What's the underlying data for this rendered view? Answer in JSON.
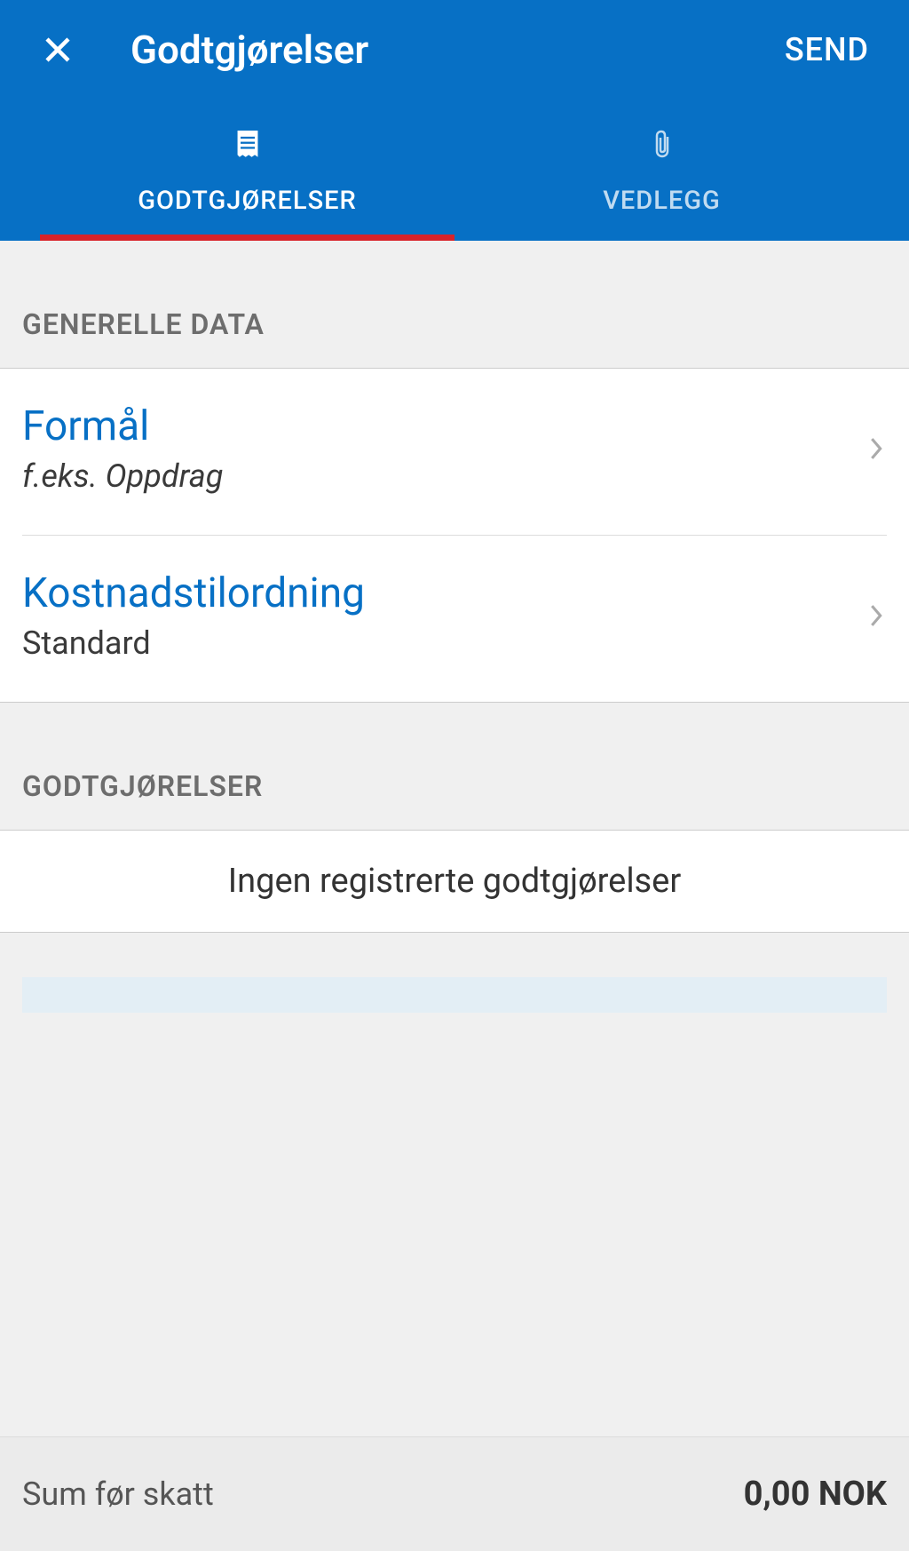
{
  "header": {
    "title": "Godtgjørelser",
    "send_label": "SEND"
  },
  "tabs": {
    "compensations": "GODTGJØRELSER",
    "attachments": "VEDLEGG"
  },
  "sections": {
    "general_data": "GENERELLE DATA",
    "compensations": "GODTGJØRELSER"
  },
  "items": {
    "purpose": {
      "title": "Formål",
      "subtitle": "f.eks. Oppdrag"
    },
    "cost_assignment": {
      "title": "Kostnadstilordning",
      "subtitle": "Standard"
    }
  },
  "empty_compensations": "Ingen registrerte godtgjørelser",
  "footer": {
    "label": "Sum før skatt",
    "value": "0,00 NOK"
  }
}
